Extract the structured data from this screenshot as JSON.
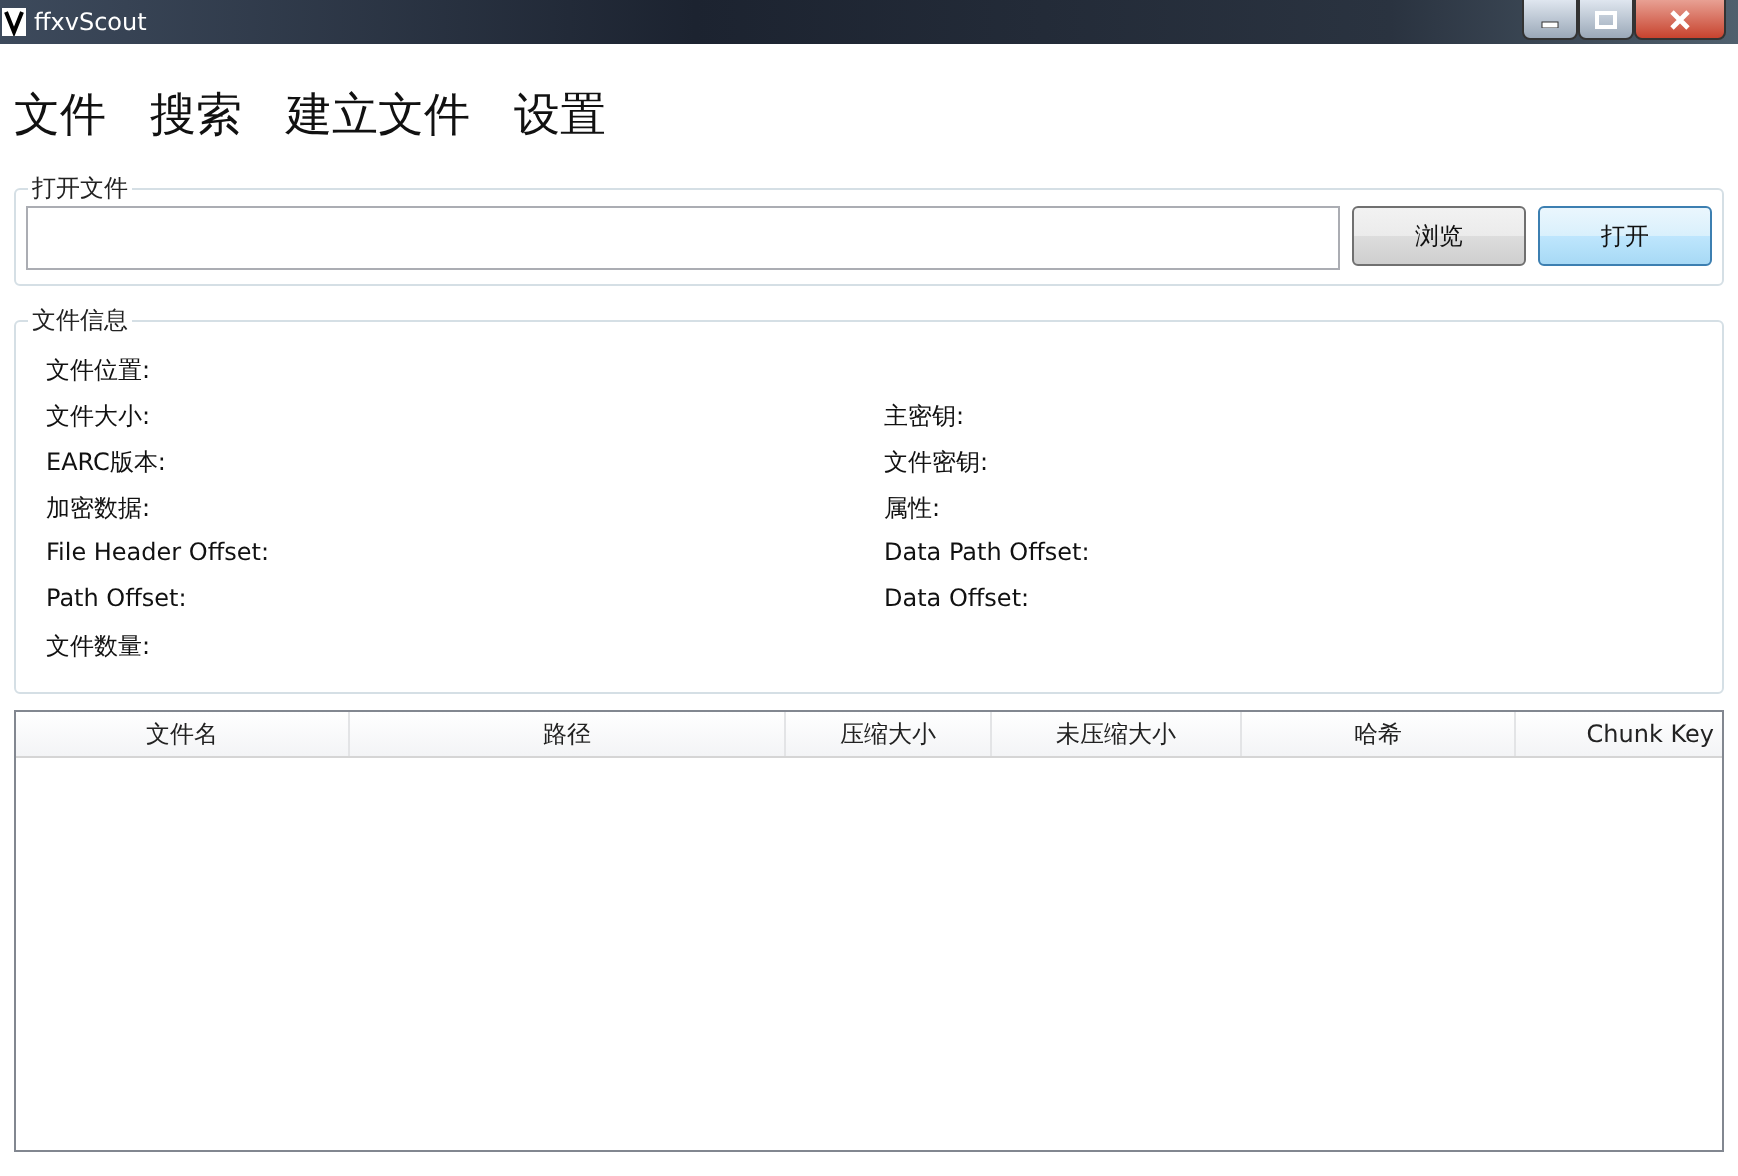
{
  "window": {
    "title": "ffxvScout"
  },
  "menu": [
    {
      "label": "文件"
    },
    {
      "label": "搜索"
    },
    {
      "label": "建立文件"
    },
    {
      "label": "设置"
    }
  ],
  "open_file": {
    "title": "打开文件",
    "buttons": [
      {
        "label": "浏览",
        "selected": false
      },
      {
        "label": "打开",
        "selected": true
      }
    ]
  },
  "file_info": {
    "title": "文件信息",
    "rows": [
      {
        "left": "文件位置:"
      },
      {
        "left": "文件大小:",
        "right": "主密钥:"
      },
      {
        "left": "EARC版本:",
        "right": "文件密钥:"
      },
      {
        "left": "加密数据:",
        "right": "属性:"
      },
      {
        "left": "File Header Offset:",
        "right": "Data Path Offset:"
      },
      {
        "left": "Path Offset:",
        "right": "Data Offset:"
      },
      {
        "left": "文件数量:"
      }
    ]
  },
  "table": {
    "columns": [
      {
        "label": "文件名"
      },
      {
        "label": "路径"
      },
      {
        "label": "压缩大小"
      },
      {
        "label": "未压缩大小"
      },
      {
        "label": "哈希"
      },
      {
        "label": "Chunk Key"
      }
    ]
  }
}
